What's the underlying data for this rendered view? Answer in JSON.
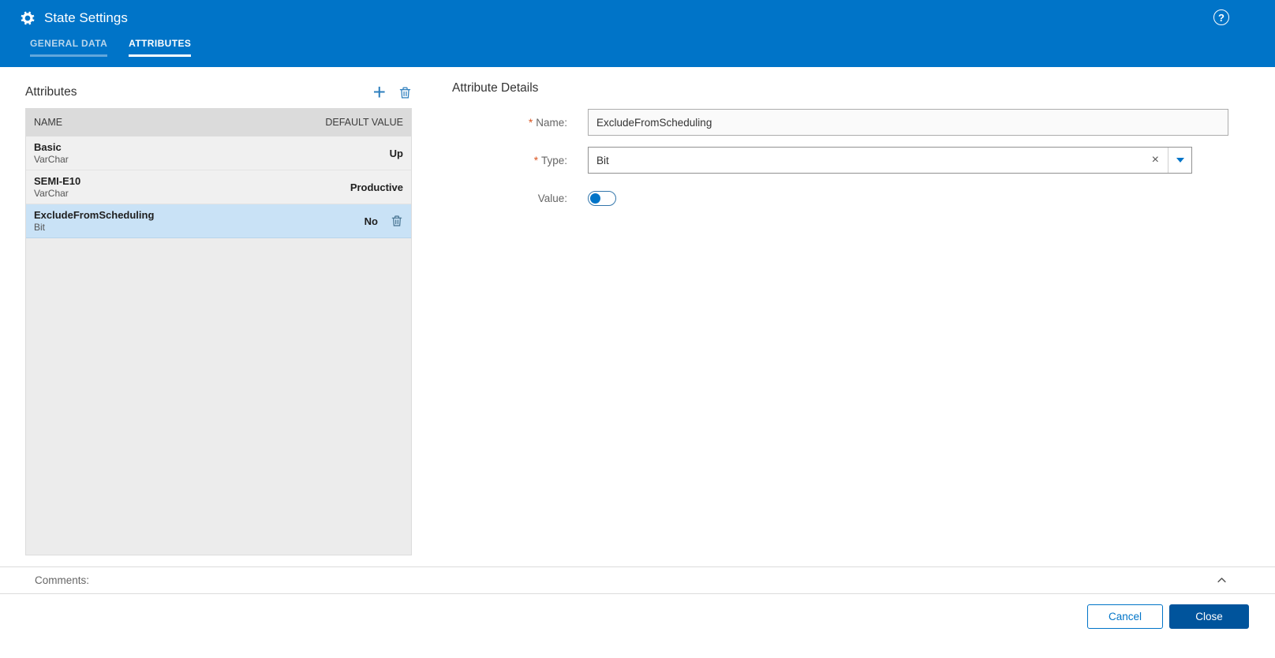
{
  "window": {
    "title": "State Settings"
  },
  "icons": {
    "help": "?",
    "add": "+",
    "clear": "×"
  },
  "tabs": [
    {
      "label": "GENERAL DATA",
      "active": false
    },
    {
      "label": "ATTRIBUTES",
      "active": true
    }
  ],
  "attributes_panel": {
    "title": "Attributes",
    "columns": {
      "name": "NAME",
      "default_value": "DEFAULT VALUE"
    },
    "rows": [
      {
        "name": "Basic",
        "type": "VarChar",
        "value": "Up"
      },
      {
        "name": "SEMI-E10",
        "type": "VarChar",
        "value": "Productive"
      },
      {
        "name": "ExcludeFromScheduling",
        "type": "Bit",
        "value": "No"
      }
    ],
    "selected_row": "ExcludeFromScheduling"
  },
  "details_panel": {
    "title": "Attribute Details",
    "fields": {
      "name": {
        "required": "*",
        "label": "Name:",
        "value": "ExcludeFromScheduling"
      },
      "type": {
        "required": "*",
        "label": "Type:",
        "value": "Bit"
      },
      "value": {
        "label": "Value:",
        "state": "off"
      }
    }
  },
  "comments": {
    "label": "Comments:"
  },
  "footer": {
    "cancel": "Cancel",
    "close": "Close"
  },
  "colors": {
    "header_blue": "#0074C8",
    "selected_row_bg": "#C9E2F6",
    "table_header_bg": "#DBDBDB",
    "close_button_bg": "#00549C",
    "accent_blue": "#2E7FBE",
    "required_asterisk": "#D9531F"
  }
}
